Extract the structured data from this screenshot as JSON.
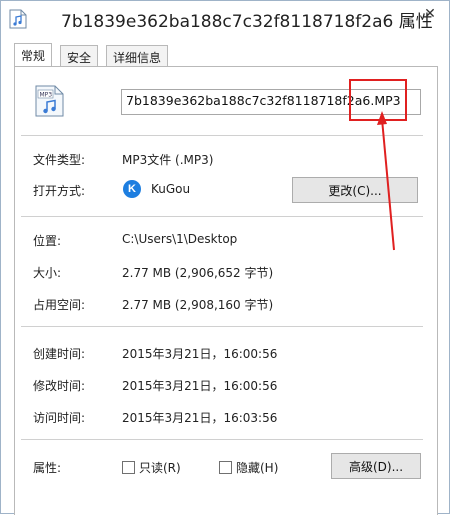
{
  "window": {
    "title": "7b1839e362ba188c7c32f8118718f2a6 属性",
    "close_glyph": "✕"
  },
  "tabs": [
    {
      "label": "常规"
    },
    {
      "label": "安全"
    },
    {
      "label": "详细信息"
    }
  ],
  "general": {
    "file_name": "7b1839e362ba188c7c32f8118718f2a6.MP3",
    "file_type_label": "文件类型:",
    "file_type_value": "MP3文件 (.MP3)",
    "open_with_label": "打开方式:",
    "open_with_value": "KuGou",
    "open_with_icon": "kugou-icon",
    "change_button": "更改(C)...",
    "location_label": "位置:",
    "location_value": "C:\\Users\\1\\Desktop",
    "size_label": "大小:",
    "size_value": "2.77 MB (2,906,652 字节)",
    "disk_size_label": "占用空间:",
    "disk_size_value": "2.77 MB (2,908,160 字节)",
    "created_label": "创建时间:",
    "created_value": "2015年3月21日，16:00:56",
    "modified_label": "修改时间:",
    "modified_value": "2015年3月21日，16:00:56",
    "accessed_label": "访问时间:",
    "accessed_value": "2015年3月21日，16:03:56",
    "attributes_label": "属性:",
    "readonly_label": "只读(R)",
    "readonly_checked": false,
    "hidden_label": "隐藏(H)",
    "hidden_checked": false,
    "advanced_button": "高级(D)..."
  },
  "colors": {
    "annotation": "#e02020",
    "kugou_blue": "#1d7ee0"
  }
}
